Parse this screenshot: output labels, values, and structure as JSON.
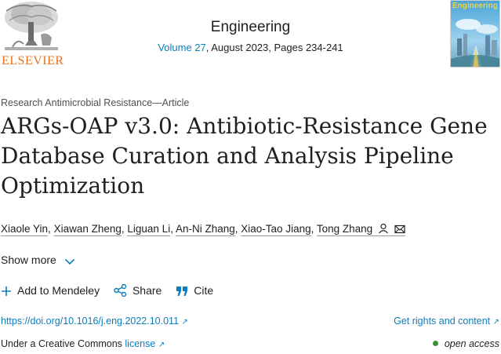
{
  "publisher": {
    "name": "ELSEVIER",
    "logo_icon": "elsevier-tree-logo"
  },
  "journal": {
    "name": "Engineering",
    "volume_link": "Volume 27",
    "details": ", August 2023, Pages 234-241",
    "cover_title": "Engineering"
  },
  "article": {
    "type": "Research Antimicrobial Resistance—Article",
    "title": "ARGs-OAP v3.0: Antibiotic-Resistance Gene Database Curation and Analysis Pipeline Optimization",
    "authors": [
      "Xiaole Yin",
      "Xiawan Zheng",
      "Liguan Li",
      "An-Ni Zhang",
      "Xiao-Tao Jiang",
      "Tong Zhang"
    ],
    "show_more": "Show more"
  },
  "actions": {
    "add_to_mendeley": "Add to Mendeley",
    "share": "Share",
    "cite": "Cite"
  },
  "links": {
    "doi": "https://doi.org/10.1016/j.eng.2022.10.011",
    "rights": "Get rights and content",
    "license_prefix": "Under a Creative Commons ",
    "license_link": "license",
    "open_access": "open access"
  },
  "colors": {
    "link": "#0c7dbb",
    "elsevier_orange": "#e9711c",
    "open_access_dot": "#3f8f3a"
  }
}
